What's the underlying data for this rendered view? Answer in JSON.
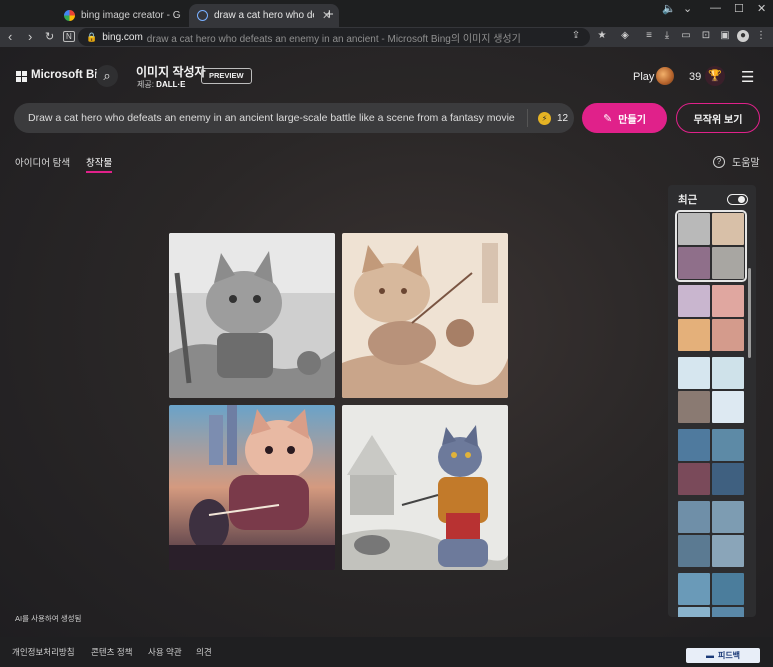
{
  "browser": {
    "tabs": [
      {
        "title": "bing image creator - Googl",
        "active": false
      },
      {
        "title": "draw a cat hero who defeat",
        "active": true
      }
    ],
    "url_domain": "bing.com",
    "url_rest": "draw a cat hero who defeats an enemy in an ancient - Microsoft Bing의 이미지 생성기"
  },
  "header": {
    "brand": "Microsoft Bing",
    "product": "이미지 작성자",
    "provider_prefix": "제공: ",
    "provider_name": "DALL·E",
    "preview_badge": "PREVIEW",
    "play_label": "Play",
    "points": "39"
  },
  "prompt": {
    "text": "Draw a cat hero who defeats an enemy in an ancient large-scale battle like a scene from a fantasy movie",
    "boosts": "12",
    "create_label": "만들기",
    "surprise_label": "무작위 보기"
  },
  "subnav": {
    "explore": "아이디어 탐색",
    "creations": "창작물",
    "help": "도움말"
  },
  "recent": {
    "title": "최근"
  },
  "footer": {
    "ai_note": "AI를 사용하여 생성됨",
    "links": [
      "개인정보처리방침",
      "콘텐츠 정책",
      "사용 약관",
      "의견"
    ],
    "feedback": "피드백"
  }
}
